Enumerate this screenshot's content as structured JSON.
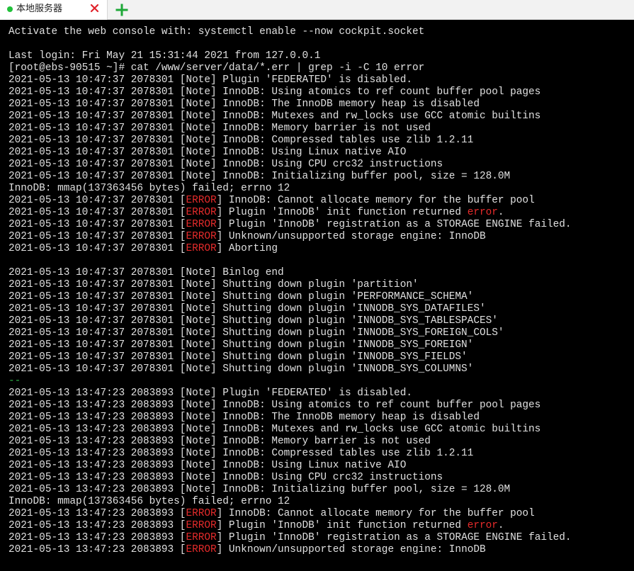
{
  "tab": {
    "label": "本地服务器",
    "status_icon": "status-dot-icon",
    "status_color": "#21c13a",
    "close_icon": "close-icon",
    "close_color": "#e0222a"
  },
  "new_tab": {
    "icon": "plus-icon",
    "color": "#1ea838"
  },
  "colors": {
    "terminal_background": "#000000",
    "terminal_text": "#e0e0e0",
    "error_keyword": "#e52b2b",
    "separator": "#2fb84a"
  },
  "terminal": {
    "lines": [
      [
        {
          "t": "Activate the web console with: systemctl enable --now cockpit.socket"
        }
      ],
      [
        {
          "t": ""
        }
      ],
      [
        {
          "t": "Last login: Fri May 21 15:31:44 2021 from 127.0.0.1"
        }
      ],
      [
        {
          "t": "[root@ebs-90515 ~]# cat /www/server/data/*.err | grep -i -C 10 error"
        }
      ],
      [
        {
          "t": "2021-05-13 10:47:37 2078301 [Note] Plugin 'FEDERATED' is disabled."
        }
      ],
      [
        {
          "t": "2021-05-13 10:47:37 2078301 [Note] InnoDB: Using atomics to ref count buffer pool pages"
        }
      ],
      [
        {
          "t": "2021-05-13 10:47:37 2078301 [Note] InnoDB: The InnoDB memory heap is disabled"
        }
      ],
      [
        {
          "t": "2021-05-13 10:47:37 2078301 [Note] InnoDB: Mutexes and rw_locks use GCC atomic builtins"
        }
      ],
      [
        {
          "t": "2021-05-13 10:47:37 2078301 [Note] InnoDB: Memory barrier is not used"
        }
      ],
      [
        {
          "t": "2021-05-13 10:47:37 2078301 [Note] InnoDB: Compressed tables use zlib 1.2.11"
        }
      ],
      [
        {
          "t": "2021-05-13 10:47:37 2078301 [Note] InnoDB: Using Linux native AIO"
        }
      ],
      [
        {
          "t": "2021-05-13 10:47:37 2078301 [Note] InnoDB: Using CPU crc32 instructions"
        }
      ],
      [
        {
          "t": "2021-05-13 10:47:37 2078301 [Note] InnoDB: Initializing buffer pool, size = 128.0M"
        }
      ],
      [
        {
          "t": "InnoDB: mmap(137363456 bytes) failed; errno 12"
        }
      ],
      [
        {
          "t": "2021-05-13 10:47:37 2078301 ["
        },
        {
          "t": "ERROR",
          "c": "error"
        },
        {
          "t": "] InnoDB: Cannot allocate memory for the buffer pool"
        }
      ],
      [
        {
          "t": "2021-05-13 10:47:37 2078301 ["
        },
        {
          "t": "ERROR",
          "c": "error"
        },
        {
          "t": "] Plugin 'InnoDB' init function returned "
        },
        {
          "t": "error",
          "c": "error"
        },
        {
          "t": "."
        }
      ],
      [
        {
          "t": "2021-05-13 10:47:37 2078301 ["
        },
        {
          "t": "ERROR",
          "c": "error"
        },
        {
          "t": "] Plugin 'InnoDB' registration as a STORAGE ENGINE failed."
        }
      ],
      [
        {
          "t": "2021-05-13 10:47:37 2078301 ["
        },
        {
          "t": "ERROR",
          "c": "error"
        },
        {
          "t": "] Unknown/unsupported storage engine: InnoDB"
        }
      ],
      [
        {
          "t": "2021-05-13 10:47:37 2078301 ["
        },
        {
          "t": "ERROR",
          "c": "error"
        },
        {
          "t": "] Aborting"
        }
      ],
      [
        {
          "t": ""
        }
      ],
      [
        {
          "t": "2021-05-13 10:47:37 2078301 [Note] Binlog end"
        }
      ],
      [
        {
          "t": "2021-05-13 10:47:37 2078301 [Note] Shutting down plugin 'partition'"
        }
      ],
      [
        {
          "t": "2021-05-13 10:47:37 2078301 [Note] Shutting down plugin 'PERFORMANCE_SCHEMA'"
        }
      ],
      [
        {
          "t": "2021-05-13 10:47:37 2078301 [Note] Shutting down plugin 'INNODB_SYS_DATAFILES'"
        }
      ],
      [
        {
          "t": "2021-05-13 10:47:37 2078301 [Note] Shutting down plugin 'INNODB_SYS_TABLESPACES'"
        }
      ],
      [
        {
          "t": "2021-05-13 10:47:37 2078301 [Note] Shutting down plugin 'INNODB_SYS_FOREIGN_COLS'"
        }
      ],
      [
        {
          "t": "2021-05-13 10:47:37 2078301 [Note] Shutting down plugin 'INNODB_SYS_FOREIGN'"
        }
      ],
      [
        {
          "t": "2021-05-13 10:47:37 2078301 [Note] Shutting down plugin 'INNODB_SYS_FIELDS'"
        }
      ],
      [
        {
          "t": "2021-05-13 10:47:37 2078301 [Note] Shutting down plugin 'INNODB_SYS_COLUMNS'"
        }
      ],
      [
        {
          "t": "--",
          "c": "sep"
        }
      ],
      [
        {
          "t": "2021-05-13 13:47:23 2083893 [Note] Plugin 'FEDERATED' is disabled."
        }
      ],
      [
        {
          "t": "2021-05-13 13:47:23 2083893 [Note] InnoDB: Using atomics to ref count buffer pool pages"
        }
      ],
      [
        {
          "t": "2021-05-13 13:47:23 2083893 [Note] InnoDB: The InnoDB memory heap is disabled"
        }
      ],
      [
        {
          "t": "2021-05-13 13:47:23 2083893 [Note] InnoDB: Mutexes and rw_locks use GCC atomic builtins"
        }
      ],
      [
        {
          "t": "2021-05-13 13:47:23 2083893 [Note] InnoDB: Memory barrier is not used"
        }
      ],
      [
        {
          "t": "2021-05-13 13:47:23 2083893 [Note] InnoDB: Compressed tables use zlib 1.2.11"
        }
      ],
      [
        {
          "t": "2021-05-13 13:47:23 2083893 [Note] InnoDB: Using Linux native AIO"
        }
      ],
      [
        {
          "t": "2021-05-13 13:47:23 2083893 [Note] InnoDB: Using CPU crc32 instructions"
        }
      ],
      [
        {
          "t": "2021-05-13 13:47:23 2083893 [Note] InnoDB: Initializing buffer pool, size = 128.0M"
        }
      ],
      [
        {
          "t": "InnoDB: mmap(137363456 bytes) failed; errno 12"
        }
      ],
      [
        {
          "t": "2021-05-13 13:47:23 2083893 ["
        },
        {
          "t": "ERROR",
          "c": "error"
        },
        {
          "t": "] InnoDB: Cannot allocate memory for the buffer pool"
        }
      ],
      [
        {
          "t": "2021-05-13 13:47:23 2083893 ["
        },
        {
          "t": "ERROR",
          "c": "error"
        },
        {
          "t": "] Plugin 'InnoDB' init function returned "
        },
        {
          "t": "error",
          "c": "error"
        },
        {
          "t": "."
        }
      ],
      [
        {
          "t": "2021-05-13 13:47:23 2083893 ["
        },
        {
          "t": "ERROR",
          "c": "error"
        },
        {
          "t": "] Plugin 'InnoDB' registration as a STORAGE ENGINE failed."
        }
      ],
      [
        {
          "t": "2021-05-13 13:47:23 2083893 ["
        },
        {
          "t": "ERROR",
          "c": "error"
        },
        {
          "t": "] Unknown/unsupported storage engine: InnoDB"
        }
      ]
    ]
  }
}
